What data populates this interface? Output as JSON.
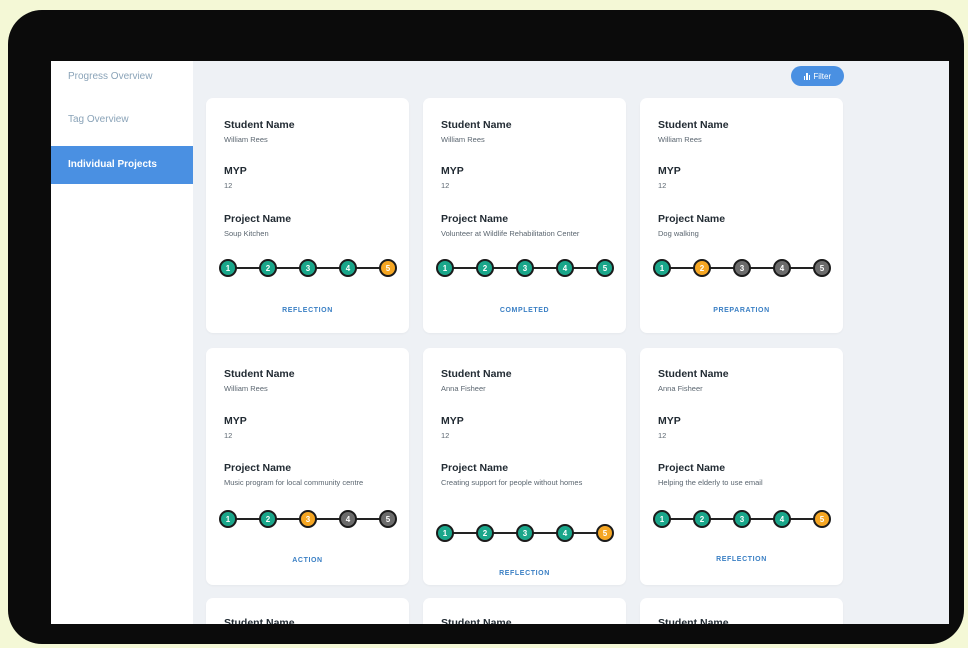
{
  "sidebar": {
    "items": [
      {
        "label": "Progress Overview",
        "active": false
      },
      {
        "label": "Tag Overview",
        "active": false
      },
      {
        "label": "Individual Projects",
        "active": true
      }
    ]
  },
  "toolbar": {
    "filter_label": "Filter",
    "filter_icon": "bar-chart-icon"
  },
  "labels": {
    "student": "Student Name",
    "myp": "MYP",
    "project": "Project Name"
  },
  "cards": [
    {
      "student": "William Rees",
      "myp": "12",
      "project": "Soup Kitchen",
      "status": "REFLECTION",
      "steps": [
        "1",
        "2",
        "3",
        "4",
        "5"
      ],
      "step_states": [
        "done",
        "done",
        "done",
        "done",
        "current"
      ]
    },
    {
      "student": "William Rees",
      "myp": "12",
      "project": "Volunteer at Wildlife Rehabilitation Center",
      "status": "COMPLETED",
      "steps": [
        "1",
        "2",
        "3",
        "4",
        "5"
      ],
      "step_states": [
        "done",
        "done",
        "done",
        "done",
        "done"
      ]
    },
    {
      "student": "William Rees",
      "myp": "12",
      "project": "Dog walking",
      "status": "PREPARATION",
      "steps": [
        "1",
        "2",
        "3",
        "4",
        "5"
      ],
      "step_states": [
        "done",
        "current",
        "todo",
        "todo",
        "todo"
      ]
    },
    {
      "student": "William Rees",
      "myp": "12",
      "project": "Music program for local community centre",
      "status": "ACTION",
      "steps": [
        "1",
        "2",
        "3",
        "4",
        "5"
      ],
      "step_states": [
        "done",
        "done",
        "current",
        "todo",
        "todo"
      ]
    },
    {
      "student": "Anna Fisheer",
      "myp": "12",
      "project": "Creating support for people without homes",
      "status": "REFLECTION",
      "steps": [
        "1",
        "2",
        "3",
        "4",
        "5"
      ],
      "step_states": [
        "done",
        "done",
        "done",
        "done",
        "current"
      ]
    },
    {
      "student": "Anna Fisheer",
      "myp": "12",
      "project": "Helping the elderly to use email",
      "status": "REFLECTION",
      "steps": [
        "1",
        "2",
        "3",
        "4",
        "5"
      ],
      "step_states": [
        "done",
        "done",
        "done",
        "done",
        "current"
      ]
    }
  ],
  "colors": {
    "done": "#1aa68a",
    "current": "#f5a623",
    "todo": "#6b6b6b",
    "accent": "#4a90e2"
  }
}
